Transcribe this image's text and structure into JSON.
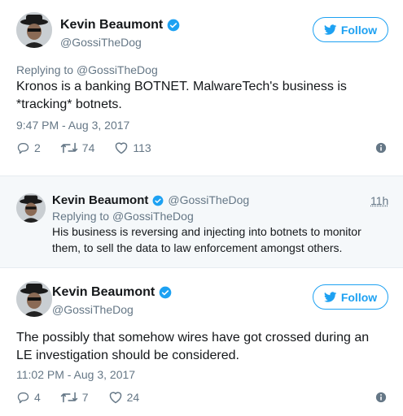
{
  "tweets": [
    {
      "author_name": "Kevin Beaumont",
      "author_handle": "@GossiTheDog",
      "follow_label": "Follow",
      "replying_prefix": "Replying to",
      "replying_handle": "@GossiTheDog",
      "text": "Kronos is a banking BOTNET. MalwareTech's business is *tracking* botnets.",
      "timestamp": "9:47 PM - Aug 3, 2017",
      "replies": "2",
      "retweets": "74",
      "likes": "113"
    },
    {
      "author_name": "Kevin Beaumont",
      "author_handle": "@GossiTheDog",
      "time_ago": "11h",
      "replying_prefix": "Replying to",
      "replying_handle": "@GossiTheDog",
      "text": "His business is reversing and injecting into botnets to monitor them, to sell the data to law enforcement amongst others."
    },
    {
      "author_name": "Kevin Beaumont",
      "author_handle": "@GossiTheDog",
      "follow_label": "Follow",
      "text": "The possibly that somehow wires have got crossed during an LE investigation should be considered.",
      "timestamp": "11:02 PM - Aug 3, 2017",
      "replies": "4",
      "retweets": "7",
      "likes": "24"
    }
  ],
  "colors": {
    "accent": "#1da1f2",
    "muted": "#657786",
    "text": "#14171a",
    "quote_bg": "#f5f8fa"
  },
  "icons": [
    "avatar",
    "verified-badge-icon",
    "twitter-bird-icon",
    "reply-icon",
    "retweet-icon",
    "like-icon",
    "info-icon"
  ]
}
